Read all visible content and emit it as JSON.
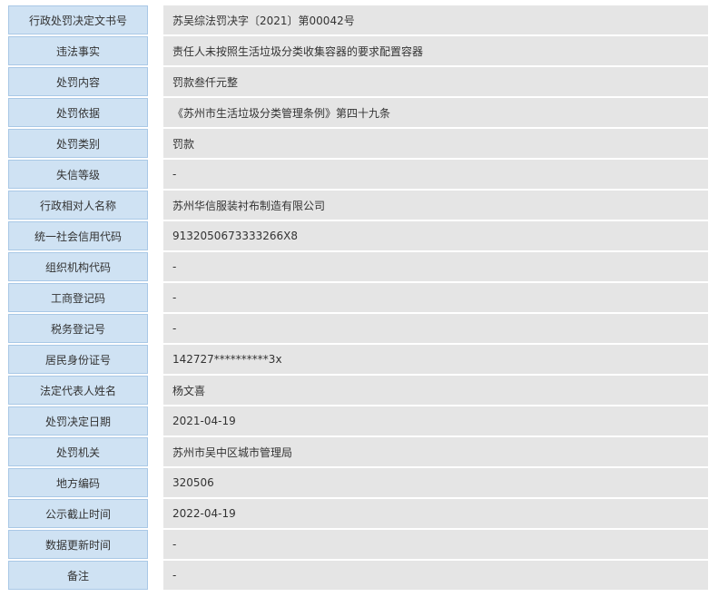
{
  "record": {
    "rows": [
      {
        "label": "行政处罚决定文书号",
        "value": "苏吴综法罚决字〔2021〕第00042号"
      },
      {
        "label": "违法事实",
        "value": "责任人未按照生活垃圾分类收集容器的要求配置容器"
      },
      {
        "label": "处罚内容",
        "value": "罚款叁仟元整"
      },
      {
        "label": "处罚依据",
        "value": "《苏州市生活垃圾分类管理条例》第四十九条"
      },
      {
        "label": "处罚类别",
        "value": "罚款"
      },
      {
        "label": "失信等级",
        "value": "-"
      },
      {
        "label": "行政相对人名称",
        "value": "苏州华信服装衬布制造有限公司"
      },
      {
        "label": "统一社会信用代码",
        "value": "9132050673333266X8"
      },
      {
        "label": "组织机构代码",
        "value": "-"
      },
      {
        "label": "工商登记码",
        "value": "-"
      },
      {
        "label": "税务登记号",
        "value": "-"
      },
      {
        "label": "居民身份证号",
        "value": "142727**********3x"
      },
      {
        "label": "法定代表人姓名",
        "value": "杨文喜"
      },
      {
        "label": "处罚决定日期",
        "value": "2021-04-19"
      },
      {
        "label": "处罚机关",
        "value": "苏州市吴中区城市管理局"
      },
      {
        "label": "地方编码",
        "value": "320506"
      },
      {
        "label": "公示截止时间",
        "value": "2022-04-19"
      },
      {
        "label": "数据更新时间",
        "value": "-"
      },
      {
        "label": "备注",
        "value": "-"
      }
    ]
  },
  "colors": {
    "label_background": "#cfe2f3",
    "label_border": "#a9c8e6",
    "value_background": "#e5e5e5",
    "text": "#333333"
  }
}
